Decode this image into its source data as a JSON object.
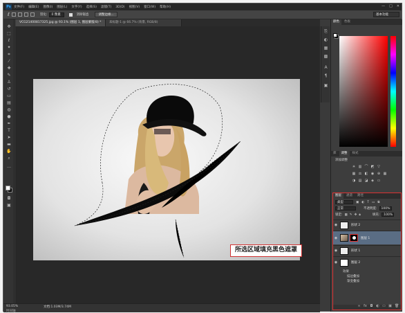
{
  "app": {
    "logo": "Ps"
  },
  "menubar": {
    "items": [
      "文件(F)",
      "编辑(E)",
      "图像(I)",
      "图层(L)",
      "文字(Y)",
      "选择(S)",
      "滤镜(T)",
      "3D(D)",
      "视图(V)",
      "窗口(W)",
      "帮助(H)"
    ],
    "controls": [
      "—",
      "□",
      "✕"
    ]
  },
  "options": {
    "feather_label": "羽化:",
    "feather_value": "0 像素",
    "antialias_label": "消除锯齿",
    "refine_button": "调整边缘...",
    "workspace": "基本功能"
  },
  "tabs": [
    {
      "label": "VCG21400817325.jpg @ 93.1% (图层 1, 图层蒙版/8) *",
      "active": true
    },
    {
      "label": "未标题-1 @ 66.7% (背景, RGB/8)",
      "active": false
    }
  ],
  "callout": {
    "text": "所选区域填充黑色遮罩"
  },
  "status": {
    "zoom": "93.05%",
    "docsize": "文档:1.03M/3.74M",
    "tab": "时间轴"
  },
  "panels": {
    "color_tabs": [
      "颜色",
      "色板"
    ],
    "adjust_tabs": [
      "库",
      "调整",
      "样式"
    ],
    "adjust_label": "添加调整",
    "layers_tabs": [
      "图层",
      "通道",
      "路径"
    ],
    "kind_filter": "类型",
    "blend_mode": "正常",
    "opacity_label": "不透明度:",
    "opacity_value": "100%",
    "lock_label": "锁定:",
    "fill_label": "填充:",
    "fill_value": "100%",
    "layers": [
      {
        "name": "形状 2",
        "thumb": "shape",
        "active": false
      },
      {
        "name": "图层 1",
        "thumb": "photo",
        "mask": true,
        "active": true
      },
      {
        "name": "形状 1",
        "thumb": "shape",
        "active": false
      },
      {
        "name": "图层 2",
        "thumb": "white",
        "active": false
      }
    ],
    "effects": [
      "效果",
      "描边叠加",
      "渐变叠加"
    ]
  }
}
